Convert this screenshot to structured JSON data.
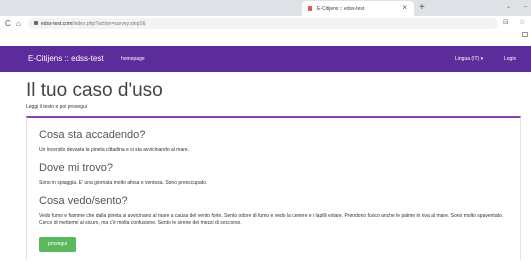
{
  "browser": {
    "tab_title": "E-Citijens :: edss-test",
    "tab_close": "×",
    "new_tab": "+",
    "url_host": "edss-test.com",
    "url_path": "/index.php?action=survey.step2&",
    "back_icon": "C",
    "home_icon": "⌂"
  },
  "navbar": {
    "brand": "E-Citijens :: edss-test",
    "homepage": "homepage",
    "language": "Lingua (IT) ▾",
    "login": "Login"
  },
  "page": {
    "title": "Il tuo caso d'uso",
    "subtitle": "Leggi il testo e poi prosegui"
  },
  "sections": [
    {
      "heading": "Cosa sta accadendo?",
      "text": "Un incendio devasta la pineta cittadina e si sta avvicinando al mare."
    },
    {
      "heading": "Dove mi trovo?",
      "text": "Sono in spiaggia. E' una giornata molto afosa e ventosa. Sono preoccupato."
    },
    {
      "heading": "Cosa vedo/sento?",
      "text": "Vedo fumo e fiamme che dalla pineta si avvicinano al mare a causa del vento forte. Sento odore di fumo e vedo la cenere e i lapilli volare. Prendono fuoco anche le palme in riva al mare. Sono molto spaventato. Cerco di mettermi al sicuro, ma c'è molta confusione. Sento le sirene dei mezzi di soccorso."
    }
  ],
  "continue_button": "prosegui",
  "colors": {
    "navbar": "#5b2c9a",
    "panel_border": "#8e44ad",
    "button": "#5cb85c"
  }
}
